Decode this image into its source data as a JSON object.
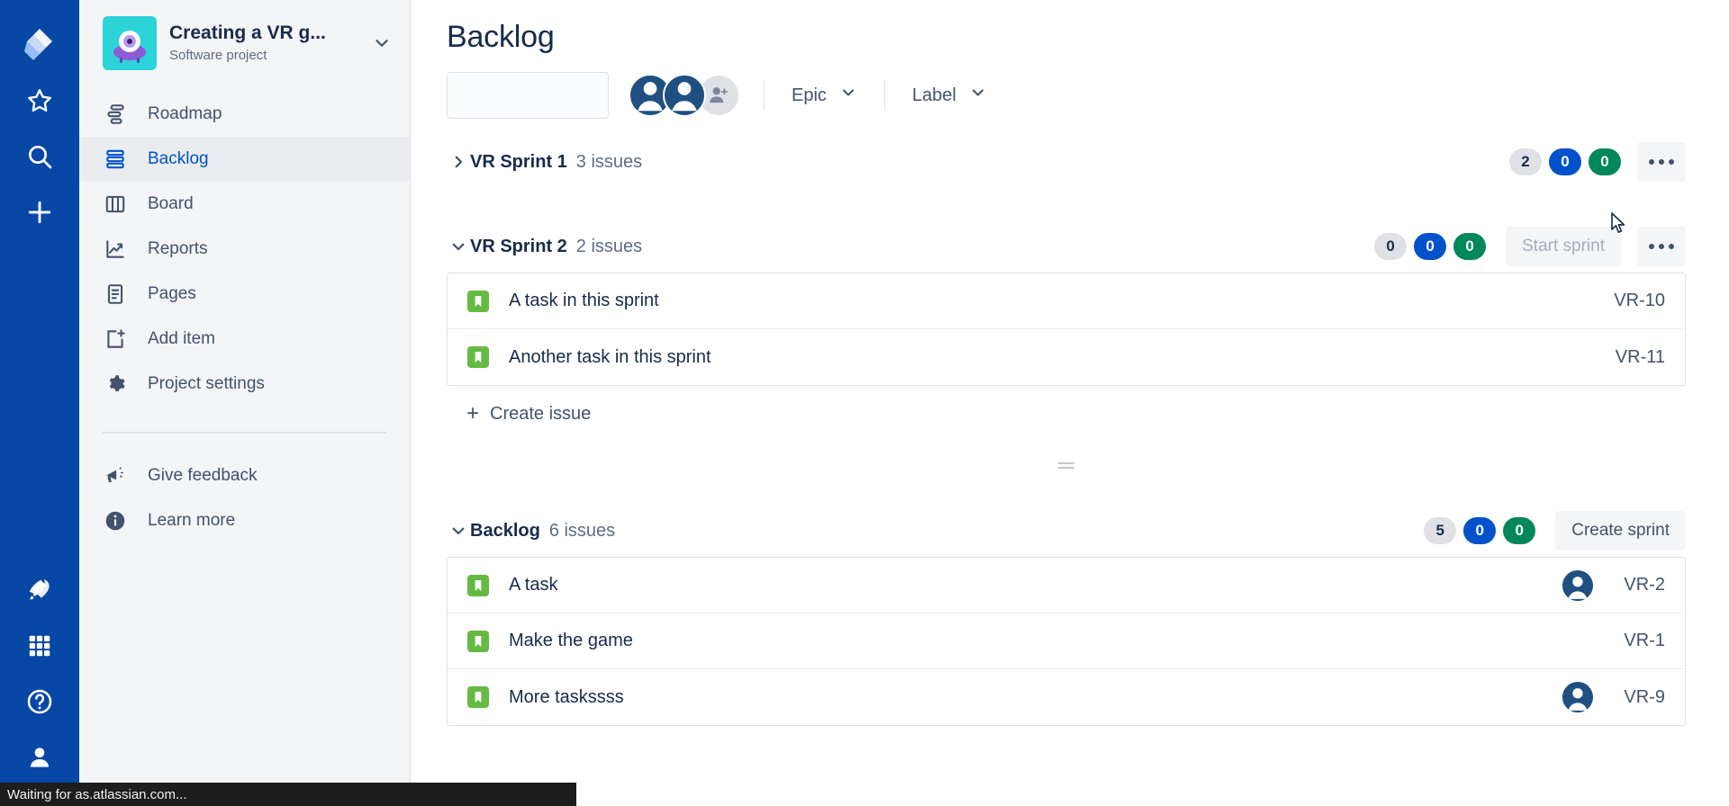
{
  "rail": {
    "icons": [
      {
        "name": "jira-logo-icon",
        "label": "Jira"
      },
      {
        "name": "star-icon",
        "label": "Starred"
      },
      {
        "name": "search-icon",
        "label": "Search"
      },
      {
        "name": "plus-icon",
        "label": "Create"
      }
    ],
    "bottom_icons": [
      {
        "name": "rocket-icon",
        "label": "Your work"
      },
      {
        "name": "apps-grid-icon",
        "label": "Apps"
      },
      {
        "name": "help-icon",
        "label": "Help"
      },
      {
        "name": "profile-icon",
        "label": "Profile"
      }
    ],
    "background": "#0747A6"
  },
  "sidebar": {
    "project": {
      "name": "Creating a VR g...",
      "type": "Software project",
      "avatar_bg": "#2BD4D9"
    },
    "items": [
      {
        "label": "Roadmap",
        "icon": "roadmap-icon",
        "active": false
      },
      {
        "label": "Backlog",
        "icon": "backlog-icon",
        "active": true
      },
      {
        "label": "Board",
        "icon": "board-icon",
        "active": false
      },
      {
        "label": "Reports",
        "icon": "reports-icon",
        "active": false
      },
      {
        "label": "Pages",
        "icon": "pages-icon",
        "active": false
      },
      {
        "label": "Add item",
        "icon": "add-item-icon",
        "active": false
      },
      {
        "label": "Project settings",
        "icon": "gear-icon",
        "active": false
      }
    ],
    "bottom_items": [
      {
        "label": "Give feedback",
        "icon": "megaphone-icon"
      },
      {
        "label": "Learn more",
        "icon": "info-icon"
      }
    ],
    "active_color": "#0052CC"
  },
  "header": {
    "title": "Backlog"
  },
  "toolbar": {
    "search": {
      "value": "",
      "placeholder": ""
    },
    "avatars": [
      {
        "name": "avatar-user-1"
      },
      {
        "name": "avatar-user-2"
      }
    ],
    "add_people_label": "+",
    "filters": [
      {
        "label": "Epic",
        "name": "epic-filter"
      },
      {
        "label": "Label",
        "name": "label-filter"
      }
    ]
  },
  "sections": [
    {
      "id": "vr-sprint-1",
      "title": "VR Sprint 1",
      "count": "3 issues",
      "expanded": false,
      "pills": [
        {
          "value": "2",
          "color": "grey"
        },
        {
          "value": "0",
          "color": "blue"
        },
        {
          "value": "0",
          "color": "green"
        }
      ],
      "action": null,
      "more_menu": true,
      "issues": [],
      "create_issue_label": null
    },
    {
      "id": "vr-sprint-2",
      "title": "VR Sprint 2",
      "count": "2 issues",
      "expanded": true,
      "pills": [
        {
          "value": "0",
          "color": "grey"
        },
        {
          "value": "0",
          "color": "blue"
        },
        {
          "value": "0",
          "color": "green"
        }
      ],
      "action": {
        "label": "Start sprint",
        "disabled": true,
        "name": "start-sprint-button"
      },
      "more_menu": true,
      "issues": [
        {
          "type": "story",
          "title": "A task in this sprint",
          "key": "VR-10",
          "assignee": false
        },
        {
          "type": "story",
          "title": "Another task in this sprint",
          "key": "VR-11",
          "assignee": false
        }
      ],
      "create_issue_label": "Create issue"
    },
    {
      "id": "backlog",
      "title": "Backlog",
      "count": "6 issues",
      "expanded": true,
      "pills": [
        {
          "value": "5",
          "color": "grey"
        },
        {
          "value": "0",
          "color": "blue"
        },
        {
          "value": "0",
          "color": "green"
        }
      ],
      "action": {
        "label": "Create sprint",
        "disabled": false,
        "name": "create-sprint-button"
      },
      "more_menu": false,
      "issues": [
        {
          "type": "story",
          "title": "A task",
          "key": "VR-2",
          "assignee": true
        },
        {
          "type": "story",
          "title": "Make the game",
          "key": "VR-1",
          "assignee": false
        },
        {
          "type": "story",
          "title": "More taskssss",
          "key": "VR-9",
          "assignee": true
        }
      ],
      "create_issue_label": null
    }
  ],
  "statusbar": {
    "text": "Waiting for as.atlassian.com..."
  },
  "colors": {
    "brand_blue": "#0052CC",
    "rail_blue": "#0747A6",
    "story_green": "#65BA43",
    "pill_green": "#00875A",
    "sidebar_bg": "#F4F5F7",
    "text": "#172B4D",
    "muted": "#5E6C84"
  }
}
